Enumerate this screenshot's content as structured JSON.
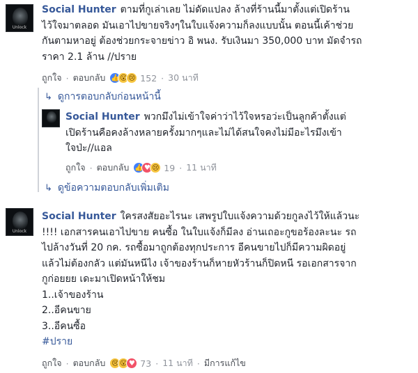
{
  "comment1": {
    "author": "Social Hunter",
    "avatar_tag": "Unlock",
    "lines": [
      "ตามที่กูเล่าเลย ไม่ดัดแปลง ล้างที่ร้านนี้มาตั้งแต่เปิดร้าน",
      "ไว้ใจมาตลอด มันเอาไปขายจริงๆในใบแจ้งความก็ลงแบบนั้น ตอนนี้เค้าช่วย",
      "กันตามหาอยู่ ต้องช่วยกระจายข่าว อิ พนง. รับเงินมา 350,000 บาท มัดจำรถ",
      "ราคา 2.1 ล้าน //ปราย"
    ],
    "like_label": "ถูกใจ",
    "reply_label": "ตอบกลับ",
    "reaction_icons": [
      "like-icon",
      "wow-icon",
      "sad-icon"
    ],
    "reaction_count": "152",
    "time": "30 นาที"
  },
  "prev_replies_link": "ดูการตอบกลับก่อนหน้านี้",
  "reply1": {
    "author": "Social Hunter",
    "avatar_tag": "Unlock",
    "lines": [
      "พวกมึงไม่เข้าใจค่าว่าไว้ใจหรอว่ะเป็นลูกค้าตั้งแต่",
      "เปิดร้านคือคงล้างหลายครั้งมากๆและไม่ได้สนใจคงไม่มีอะไรมึงเข้า",
      "ใจป่ะ//แอล"
    ],
    "like_label": "ถูกใจ",
    "reply_label": "ตอบกลับ",
    "reaction_icons": [
      "like-icon",
      "love-icon",
      "sad-icon"
    ],
    "reaction_count": "19",
    "time": "11 นาที"
  },
  "more_replies_link": "ดูข้อความตอบกลับเพิ่มเติม",
  "comment2": {
    "author": "Social Hunter",
    "avatar_tag": "Unlock",
    "lines": [
      "ใครสงสัยอะไรนะ เสพรูปใบแจ้งความด้วยกูลงไว้ให้แล้วนะ",
      "!!!! เอกสารคนเอาไปขาย คนซื้อ ในใบแจ้งก็มีลง อ่านเถอะกูขอร้องละนะ รถ",
      "ไปล้างวันที่ 20 กค. รถซื้อมาถูกต้องทุกประการ อีคนขายไปก็มีความผิดอยู่",
      "แล้วไม่ต้องกลัว แต่มันหนีไง เจ้าของร้านก็หายหัวร้านก็ปิดหนี รอเอกสารจาก",
      "กูก่อยยย เดะมาเปิดหน้าให้ชม"
    ],
    "list": [
      "1..เจ้าของร้าน",
      "2..อีคนขาย",
      "3..อีคนซื้อ"
    ],
    "hashtag": "#ปราย",
    "like_label": "ถูกใจ",
    "reply_label": "ตอบกลับ",
    "reaction_icons": [
      "sad-icon",
      "wow-icon",
      "love-icon"
    ],
    "reaction_count": "73",
    "time": "11 นาที",
    "edited": "มีการแก้ไข"
  }
}
